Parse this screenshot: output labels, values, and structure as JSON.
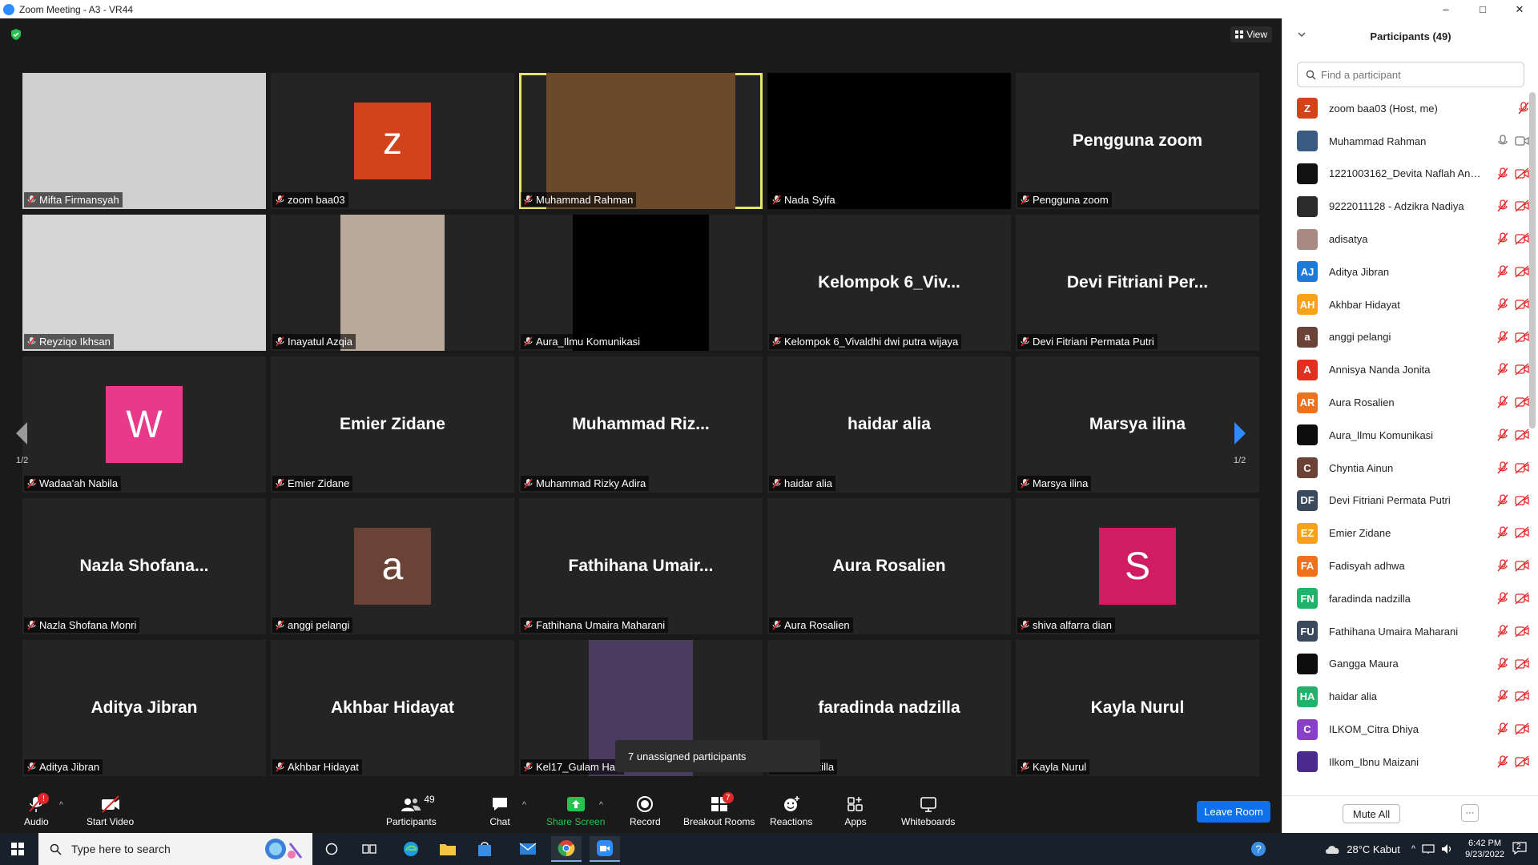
{
  "window": {
    "title": "Zoom Meeting - A3 - VR44",
    "minimize": "–",
    "maximize": "□",
    "close": "✕"
  },
  "meeting": {
    "view_label": "View",
    "page_indicator_left": "1/2",
    "page_indicator_right": "1/2",
    "unassigned_popup": "7 unassigned participants",
    "tiles": [
      {
        "label": "Mifta Firmansyah",
        "type": "video",
        "bg": "#cfcfcf"
      },
      {
        "label": "zoom baa03",
        "type": "avatar",
        "initial": "z",
        "color": "#d2431b"
      },
      {
        "label": "Muhammad Rahman",
        "type": "video",
        "bg": "#6b4a2c",
        "active": true
      },
      {
        "label": "Nada Syifa",
        "type": "black"
      },
      {
        "label": "Pengguna zoom",
        "type": "name",
        "big": "Pengguna zoom"
      },
      {
        "label": "Reyziqo Ikhsan",
        "type": "video",
        "bg": "#d6d6d6"
      },
      {
        "label": "Inayatul Azqia",
        "type": "video-narrow",
        "bg": "#b8a99a"
      },
      {
        "label": "Aura_Ilmu Komunikasi",
        "type": "black-narrow"
      },
      {
        "label": "Kelompok 6_Vivaldhi dwi putra wijaya",
        "type": "name",
        "big": "Kelompok  6_Viv..."
      },
      {
        "label": "Devi Fitriani Permata Putri",
        "type": "name",
        "big": "Devi  Fitriani  Per..."
      },
      {
        "label": "Wadaa'ah Nabila",
        "type": "avatar",
        "initial": "W",
        "color": "#e8398a"
      },
      {
        "label": "Emier Zidane",
        "type": "name",
        "big": "Emier Zidane"
      },
      {
        "label": "Muhammad Rizky Adira",
        "type": "name",
        "big": "Muhammad  Riz..."
      },
      {
        "label": "haidar alia",
        "type": "name",
        "big": "haidar alia"
      },
      {
        "label": "Marsya ilina",
        "type": "name",
        "big": "Marsya ilina"
      },
      {
        "label": "Nazla Shofana Monri",
        "type": "name",
        "big": "Nazla  Shofana..."
      },
      {
        "label": "anggi pelangi",
        "type": "avatar",
        "initial": "a",
        "color": "#6b4336"
      },
      {
        "label": "Fathihana Umaira Maharani",
        "type": "name",
        "big": "Fathihana  Umair..."
      },
      {
        "label": "Aura Rosalien",
        "type": "name",
        "big": "Aura Rosalien"
      },
      {
        "label": "shiva alfarra dian",
        "type": "avatar",
        "initial": "S",
        "color": "#d01c62"
      },
      {
        "label": "Aditya Jibran",
        "type": "name",
        "big": "Aditya Jibran"
      },
      {
        "label": "Akhbar Hidayat",
        "type": "name",
        "big": "Akhbar Hidayat"
      },
      {
        "label": "Kel17_Gulam Has",
        "type": "video-narrow",
        "bg": "#4b3b5e"
      },
      {
        "label": "da nadzilla",
        "type": "name",
        "big": "faradinda nadzilla"
      },
      {
        "label": "Kayla Nurul",
        "type": "name",
        "big": "Kayla Nurul"
      }
    ]
  },
  "toolbar": {
    "audio": "Audio",
    "start_video": "Start Video",
    "participants": "Participants",
    "participants_count": "49",
    "chat": "Chat",
    "share_screen": "Share Screen",
    "record": "Record",
    "breakout_rooms": "Breakout Rooms",
    "breakout_badge": "7",
    "reactions": "Reactions",
    "apps": "Apps",
    "whiteboards": "Whiteboards",
    "leave_room": "Leave Room"
  },
  "panel": {
    "title": "Participants (49)",
    "search_placeholder": "Find a participant",
    "mute_all": "Mute All",
    "more": "···",
    "participants": [
      {
        "name": "zoom baa03 (Host, me)",
        "initial": "Z",
        "color": "#d2431b",
        "host": true
      },
      {
        "name": "Muhammad Rahman",
        "initial": "",
        "color": "#3a5a80",
        "unmuted": true
      },
      {
        "name": "1221003162_Devita Naflah Andini",
        "initial": "",
        "color": "#111111"
      },
      {
        "name": "9222011128 - Adzikra Nadiya",
        "initial": "",
        "color": "#2b2b2b"
      },
      {
        "name": "adisatya",
        "initial": "",
        "color": "#a88a82"
      },
      {
        "name": "Aditya Jibran",
        "initial": "AJ",
        "color": "#1f7ad6"
      },
      {
        "name": "Akhbar Hidayat",
        "initial": "AH",
        "color": "#f5a31a"
      },
      {
        "name": "anggi pelangi",
        "initial": "a",
        "color": "#6b4336"
      },
      {
        "name": "Annisya Nanda Jonita",
        "initial": "A",
        "color": "#e0301e"
      },
      {
        "name": "Aura Rosalien",
        "initial": "AR",
        "color": "#f0711b"
      },
      {
        "name": "Aura_Ilmu Komunikasi",
        "initial": "",
        "color": "#0d0d0d"
      },
      {
        "name": "Chyntia Ainun",
        "initial": "C",
        "color": "#6b4336"
      },
      {
        "name": "Devi Fitriani Permata Putri",
        "initial": "DF",
        "color": "#3a4a5c"
      },
      {
        "name": "Emier Zidane",
        "initial": "EZ",
        "color": "#f5a31a"
      },
      {
        "name": "Fadisyah adhwa",
        "initial": "FA",
        "color": "#f0711b"
      },
      {
        "name": "faradinda nadzilla",
        "initial": "FN",
        "color": "#1fb36b"
      },
      {
        "name": "Fathihana Umaira Maharani",
        "initial": "FU",
        "color": "#3a4a5c"
      },
      {
        "name": "Gangga Maura",
        "initial": "",
        "color": "#0d0d0d"
      },
      {
        "name": "haidar alia",
        "initial": "HA",
        "color": "#1fb36b"
      },
      {
        "name": "ILKOM_Citra Dhiya",
        "initial": "C",
        "color": "#8a3fc7"
      },
      {
        "name": "Ilkom_Ibnu Maizani",
        "initial": "",
        "color": "#4a2a8a"
      }
    ]
  },
  "taskbar": {
    "search_placeholder": "Type here to search",
    "weather": "28°C  Kabut",
    "time": "6:42 PM",
    "date": "9/23/2022",
    "notif_count": "2"
  },
  "colors": {
    "accent_blue": "#0e71eb",
    "share_green": "#29c24f",
    "mute_red": "#e02828",
    "active_speaker": "#e6e46a"
  }
}
